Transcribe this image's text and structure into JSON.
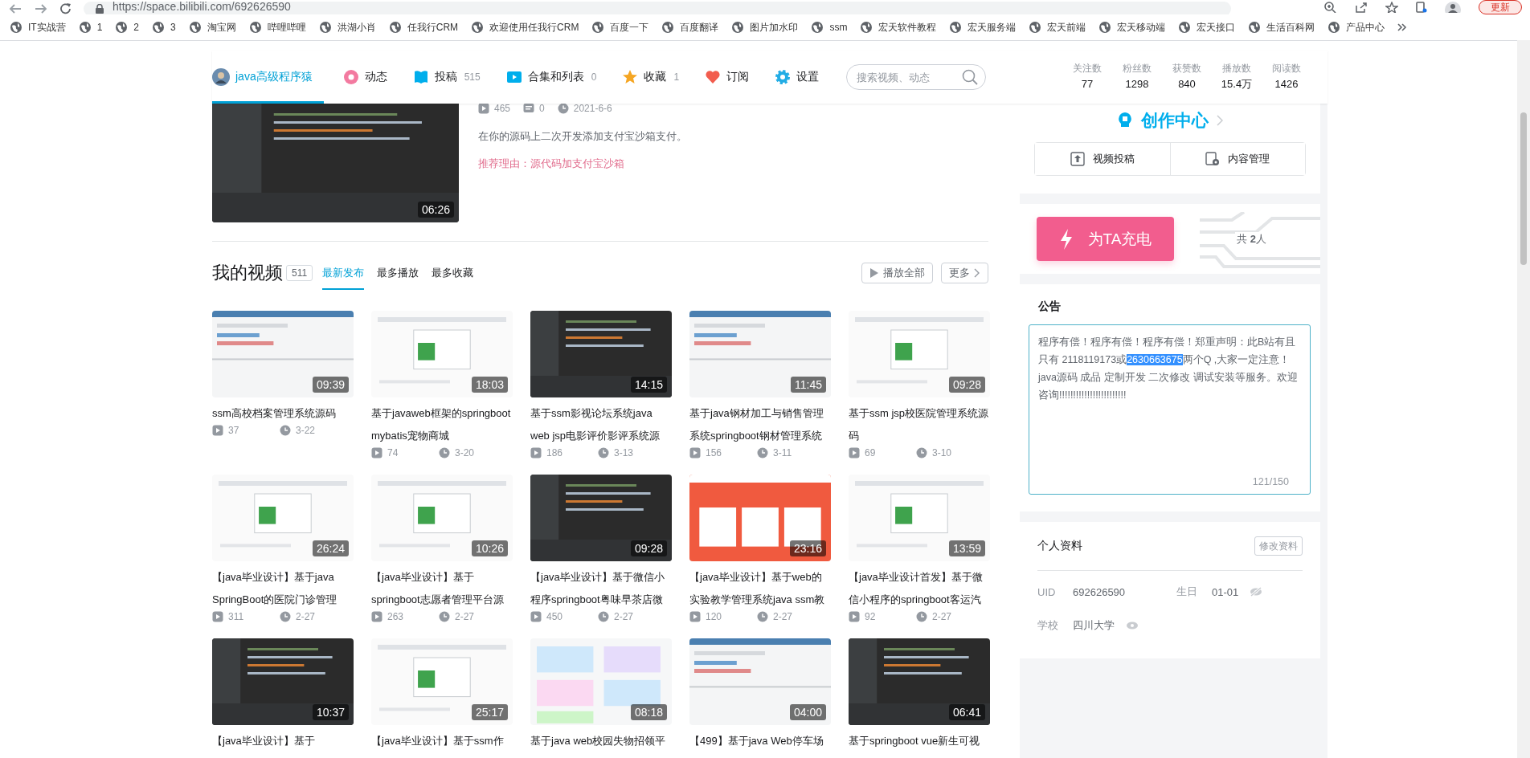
{
  "browser": {
    "url": "https://space.bilibili.com/692626590",
    "update_button": "更新",
    "bookmarks": [
      {
        "label": "IT实战营"
      },
      {
        "label": "1"
      },
      {
        "label": "2"
      },
      {
        "label": "3"
      },
      {
        "label": "淘宝网"
      },
      {
        "label": "哔哩哔哩"
      },
      {
        "label": "洪湖小肖"
      },
      {
        "label": "任我行CRM"
      },
      {
        "label": "欢迎使用任我行CRM"
      },
      {
        "label": "百度一下"
      },
      {
        "label": "百度翻译"
      },
      {
        "label": "图片加水印"
      },
      {
        "label": "ssm"
      },
      {
        "label": "宏天软件教程"
      },
      {
        "label": "宏天服务端"
      },
      {
        "label": "宏天前端"
      },
      {
        "label": "宏天移动端"
      },
      {
        "label": "宏天接口"
      },
      {
        "label": "生活百科网"
      },
      {
        "label": "产品中心"
      }
    ]
  },
  "nav": {
    "items": [
      {
        "kind": "profile",
        "label": "java高级程序猿",
        "selected": true
      },
      {
        "kind": "link",
        "label": "动态",
        "selected": false
      },
      {
        "kind": "link",
        "label": "投稿",
        "count": "515",
        "selected": false
      },
      {
        "kind": "link",
        "label": "合集和列表",
        "count": "0",
        "selected": false
      },
      {
        "kind": "link",
        "label": "收藏",
        "count": "1",
        "selected": false
      },
      {
        "kind": "link",
        "label": "订阅",
        "selected": false
      },
      {
        "kind": "link",
        "label": "设置",
        "selected": false
      }
    ],
    "search": {
      "placeholder": "搜索视频、动态"
    },
    "stats": [
      {
        "label": "关注数",
        "value": "77"
      },
      {
        "label": "粉丝数",
        "value": "1298"
      },
      {
        "label": "获赞数",
        "value": "840"
      },
      {
        "label": "播放数",
        "value": "15.4万"
      },
      {
        "label": "阅读数",
        "value": "1426"
      }
    ]
  },
  "featured": {
    "duration": "06:26",
    "plays": "465",
    "comments": "0",
    "date": "2021-6-6",
    "description": "在你的源码上二次开发添加支付宝沙箱支付。",
    "reason": "推荐理由：源代码加支付宝沙箱"
  },
  "videos": {
    "title": "我的视频",
    "count": "511",
    "tabs": [
      {
        "label": "最新发布",
        "selected": true
      },
      {
        "label": "最多播放",
        "selected": false
      },
      {
        "label": "最多收藏",
        "selected": false
      }
    ],
    "play_all": "播放全部",
    "more": "更多",
    "items": [
      {
        "title": "ssm高校档案管理系统源码",
        "duration": "09:39",
        "plays": "37",
        "date": "3-22"
      },
      {
        "title": "基于javaweb框架的springboot mybatis宠物商城",
        "duration": "18:03",
        "plays": "74",
        "date": "3-20"
      },
      {
        "title": "基于ssm影视论坛系统java web jsp电影评价影评系统源",
        "duration": "14:15",
        "plays": "186",
        "date": "3-13"
      },
      {
        "title": "基于java钢材加工与销售管理系统springboot钢材管理系统",
        "duration": "11:45",
        "plays": "156",
        "date": "3-11"
      },
      {
        "title": "基于ssm jsp校医院管理系统源码",
        "duration": "09:28",
        "plays": "69",
        "date": "3-10"
      },
      {
        "title": "【java毕业设计】基于java SpringBoot的医院门诊管理",
        "duration": "26:24",
        "plays": "311",
        "date": "2-27"
      },
      {
        "title": "【java毕业设计】基于springboot志愿者管理平台源",
        "duration": "10:26",
        "plays": "263",
        "date": "2-27"
      },
      {
        "title": "【java毕业设计】基于微信小程序springboot粤味早茶店微",
        "duration": "09:28",
        "plays": "450",
        "date": "2-27"
      },
      {
        "title": "【java毕业设计】基于web的实验教学管理系统java ssm教",
        "duration": "23:16",
        "plays": "120",
        "date": "2-27"
      },
      {
        "title": "【java毕业设计首发】基于微信小程序的springboot客运汽",
        "duration": "13:59",
        "plays": "92",
        "date": "2-27"
      },
      {
        "title": "【java毕业设计】基于",
        "duration": "10:37"
      },
      {
        "title": "【java毕业设计】基于ssm作",
        "duration": "25:17"
      },
      {
        "title": "基于java web校园失物招领平",
        "duration": "08:18"
      },
      {
        "title": "【499】基于java Web停车场",
        "duration": "04:00"
      },
      {
        "title": "基于springboot vue新生可视",
        "duration": "06:41"
      }
    ]
  },
  "sidebar": {
    "creation_center": {
      "title": "创作中心",
      "buttons": [
        "视频投稿",
        "内容管理"
      ]
    },
    "charge": {
      "button": "为TA充电",
      "count": "共 **2**人"
    },
    "announcement": {
      "title": "公告",
      "parts": [
        {
          "text": "程序有偿！程序有偿！程序有偿！郑重声明：此B站有且只有  2118119173或",
          "selected": false
        },
        {
          "text": "2630663675",
          "selected": true
        },
        {
          "text": "两个Q ,大家一定注意！  java源码 成品  定制开发  二次修改 调试安装等服务。欢迎咨询!!!!!!!!!!!!!!!!!!!!!!!!",
          "selected": false
        }
      ],
      "counter": "121/150"
    },
    "profile": {
      "title": "个人资料",
      "edit_button": "修改资料",
      "fields": [
        {
          "label": "UID",
          "value": "692626590"
        },
        {
          "label": "生日",
          "value": "01-01",
          "private": true
        },
        {
          "label": "学校",
          "value": "四川大学",
          "private": false
        }
      ]
    }
  }
}
